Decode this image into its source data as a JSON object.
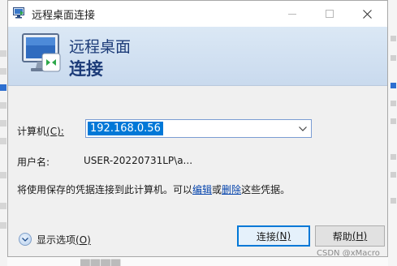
{
  "window": {
    "title": "远程桌面连接",
    "icon": "remote-desktop-icon",
    "controls": [
      "minimize",
      "maximize",
      "close"
    ]
  },
  "header": {
    "line1": "远程桌面",
    "line2": "连接"
  },
  "form": {
    "computer_label": "计算机",
    "computer_shortcut": "(C):",
    "computer_value": "192.168.0.56",
    "username_label": "用户名:",
    "username_value": "USER-20220731LP\\a...",
    "saved_note_prefix": "将使用保存的凭据连接到此计算机。可以",
    "edit_link": "编辑",
    "or_text": "或",
    "delete_link": "删除",
    "saved_note_suffix": "这些凭据。"
  },
  "footer": {
    "show_options_label": "显示选项",
    "show_options_shortcut": "(O)",
    "connect_label": "连接",
    "connect_shortcut": "(N)",
    "help_label": "帮助",
    "help_shortcut": "(H)"
  },
  "watermark": "CSDN @xMacro",
  "colors": {
    "accent": "#0078d7",
    "header_text": "#1c3b78",
    "link": "#0645ad"
  }
}
